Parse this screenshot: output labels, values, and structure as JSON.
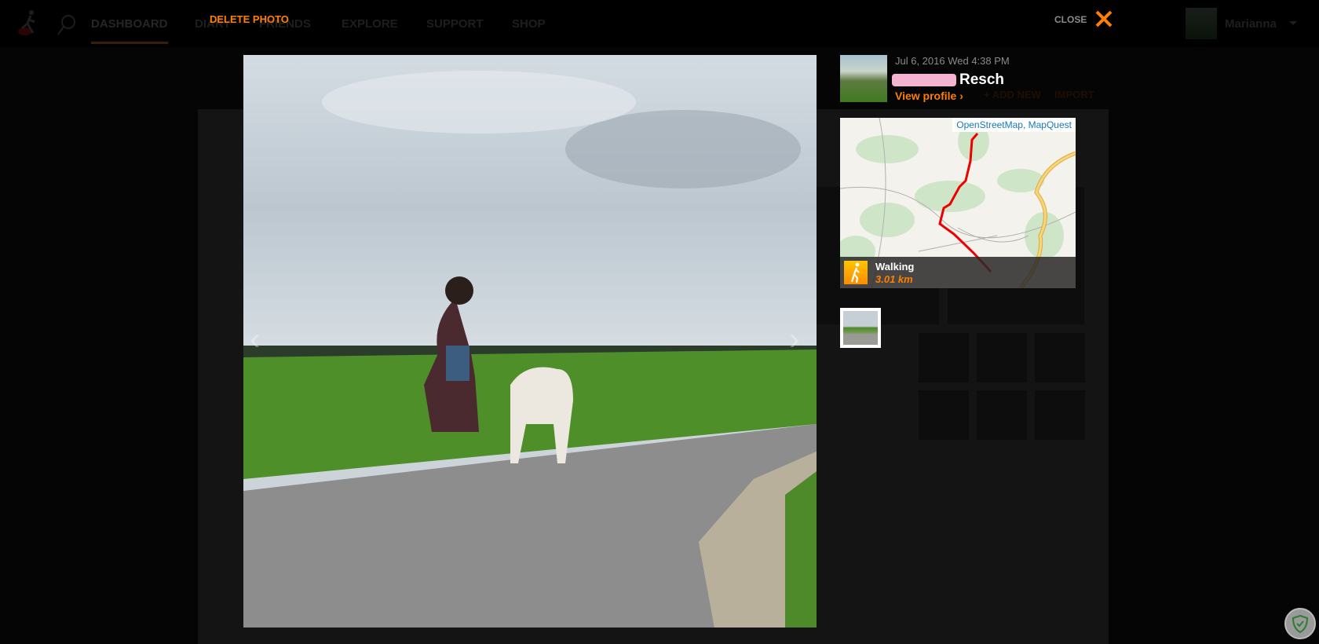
{
  "nav": {
    "items": [
      "DASHBOARD",
      "DIARY",
      "FRIENDS",
      "EXPLORE",
      "SUPPORT",
      "SHOP"
    ],
    "active": "DASHBOARD",
    "user": "Marianna"
  },
  "lightbox": {
    "delete_label": "DELETE PHOTO",
    "close_label": "CLOSE",
    "date": "Jul 6, 2016 Wed 4:38 PM",
    "name": "Resch",
    "view_profile": "View profile ›",
    "add_new": "+ ADD NEW",
    "import": "IMPORT",
    "map_attribution": "OpenStreetMap, MapQuest",
    "activity": "Walking",
    "distance": "3.01 km",
    "accent": "#ff7f00"
  }
}
